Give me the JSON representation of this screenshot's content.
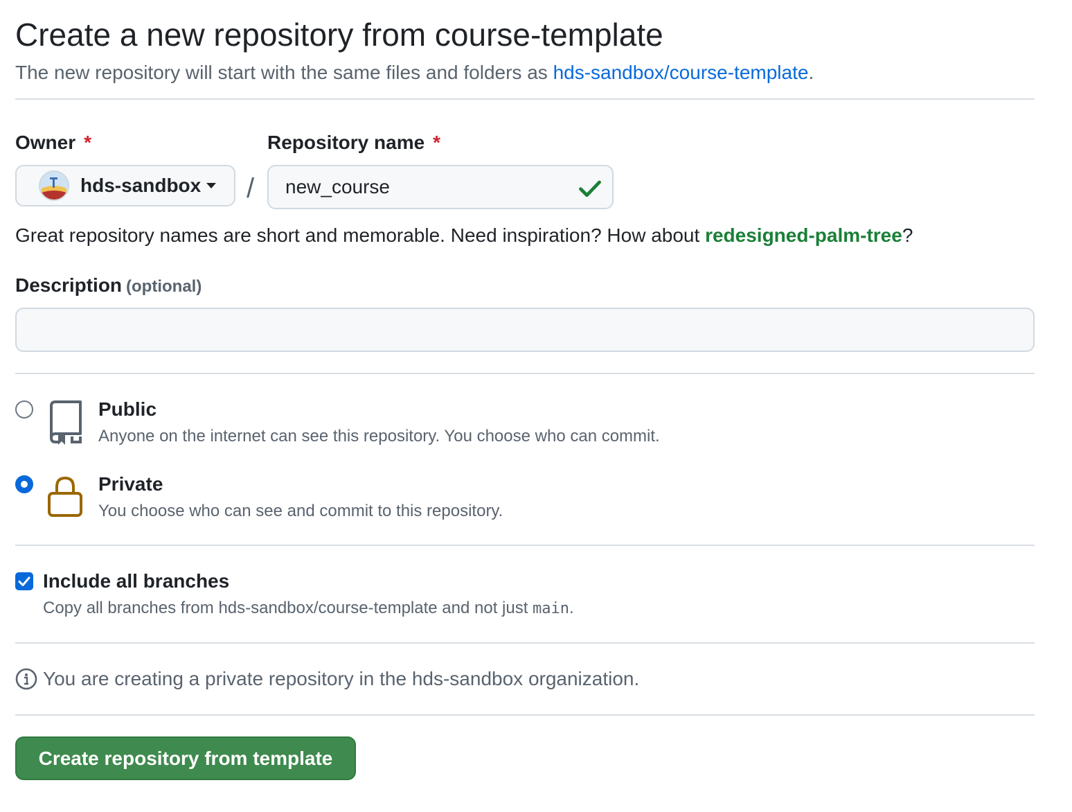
{
  "header": {
    "title": "Create a new repository from course-template",
    "subtitle_prefix": "The new repository will start with the same files and folders as ",
    "template_link": "hds-sandbox/course-template",
    "subtitle_suffix": "."
  },
  "owner": {
    "label": "Owner",
    "required_mark": "*",
    "value": "hds-sandbox"
  },
  "separator": "/",
  "repo_name": {
    "label": "Repository name",
    "required_mark": "*",
    "value": "new_course"
  },
  "hint": {
    "text": "Great repository names are short and memorable. Need inspiration? How about ",
    "suggestion": "redesigned-palm-tree",
    "suffix": "?"
  },
  "description": {
    "label": "Description",
    "optional": "(optional)",
    "value": ""
  },
  "visibility": {
    "public": {
      "title": "Public",
      "description": "Anyone on the internet can see this repository. You choose who can commit.",
      "selected": false
    },
    "private": {
      "title": "Private",
      "description": "You choose who can see and commit to this repository.",
      "selected": true
    }
  },
  "branches": {
    "label": "Include all branches",
    "description_prefix": "Copy all branches from hds-sandbox/course-template and not just ",
    "branch": "main",
    "description_suffix": ".",
    "checked": true
  },
  "info": {
    "text": "You are creating a private repository in the hds-sandbox organization."
  },
  "submit": {
    "label": "Create repository from template"
  },
  "colors": {
    "link": "#0969da",
    "suggestion": "#1a7f37",
    "primary_button": "#3f8a4e",
    "required": "#d1242f",
    "lock_icon": "#9a6700"
  }
}
